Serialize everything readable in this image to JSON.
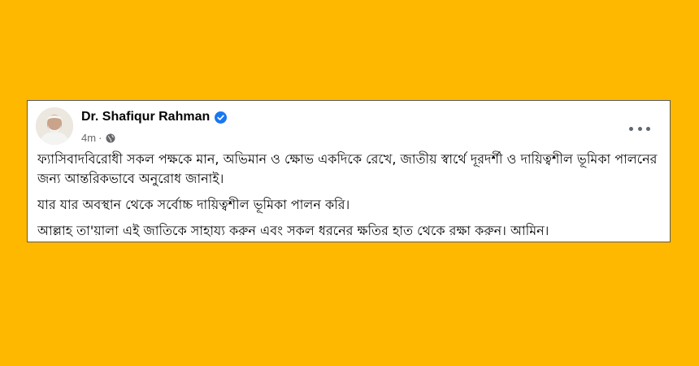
{
  "post": {
    "author": "Dr. Shafiqur Rahman",
    "time": "4m",
    "separator": "·",
    "paragraphs": [
      "ফ্যাসিবাদবিরোধী সকল পক্ষকে মান, অভিমান ও ক্ষোভ একদিকে রেখে, জাতীয় স্বার্থে দূরদর্শী ও দায়িত্বশীল ভূমিকা পালনের জন্য আন্তরিকভাবে অনুরোধ জানাই।",
      "যার যার অবস্থান থেকে সর্বোচ্চ দায়িত্বশীল ভূমিকা পালন করি।",
      "আল্লাহ তা'য়ালা এই জাতিকে সাহায্য করুন এবং সকল ধরনের ক্ষতির হাত থেকে রক্ষা করুন। আমিন।"
    ]
  },
  "icons": {
    "verified": "verified-badge-icon",
    "audience": "globe-icon",
    "menu": "more-options-icon"
  },
  "colors": {
    "background": "#FFB800",
    "card": "#FFFFFF",
    "verified": "#1877F2",
    "meta_text": "#65676B"
  }
}
